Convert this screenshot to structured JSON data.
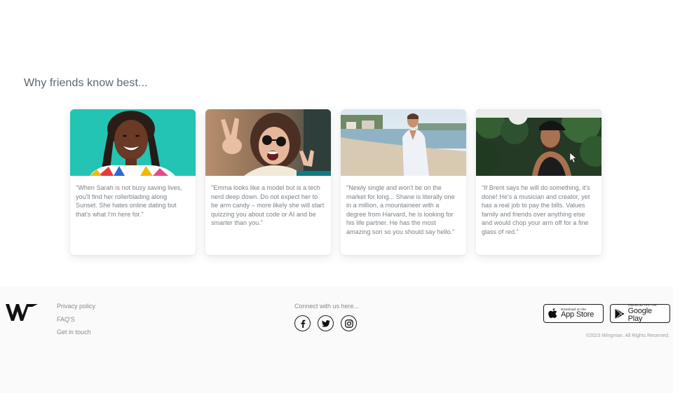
{
  "section": {
    "title": "Why friends know best..."
  },
  "cards": [
    {
      "quote": "\"When Sarah is not busy saving lives, you'll find her rollerblading along Sunset. She hates online dating but that's what I'm here for.\""
    },
    {
      "quote": "\"Emma looks like a model but is a tech nerd deep down. Do not expect her to be arm candy – more likely she will start quizzing you about code or AI and be smarter than you.\""
    },
    {
      "quote": "\"Newly single and won't be on the market for long... Shane is literally one in a million, a mountaineer with a degree from Harvard, he is looking for his life partner. He has the most amazing son so you should say hello.\""
    },
    {
      "quote": "\"If Brent says he will do something, it's done! He's a musician and creator, yet has a real job to pay the bills. Values family and friends over anything else and would chop your arm off for a fine glass of red.\""
    }
  ],
  "footer": {
    "links": [
      "Privacy policy",
      "FAQ'S",
      "Get in touch"
    ],
    "connect_label": "Connect with us here...",
    "socials": [
      "facebook-icon",
      "twitter-icon",
      "instagram-icon"
    ],
    "app_store": {
      "small": "Download on the",
      "big": "App Store"
    },
    "google_play": {
      "small": "ANDROID APP ON",
      "big": "Google Play"
    },
    "copyright": "©2023 Wingman. All Rights Reserved."
  },
  "colors": {
    "title": "#5d6670",
    "body_text": "#7b8288",
    "footer_bg": "#fafafa"
  }
}
